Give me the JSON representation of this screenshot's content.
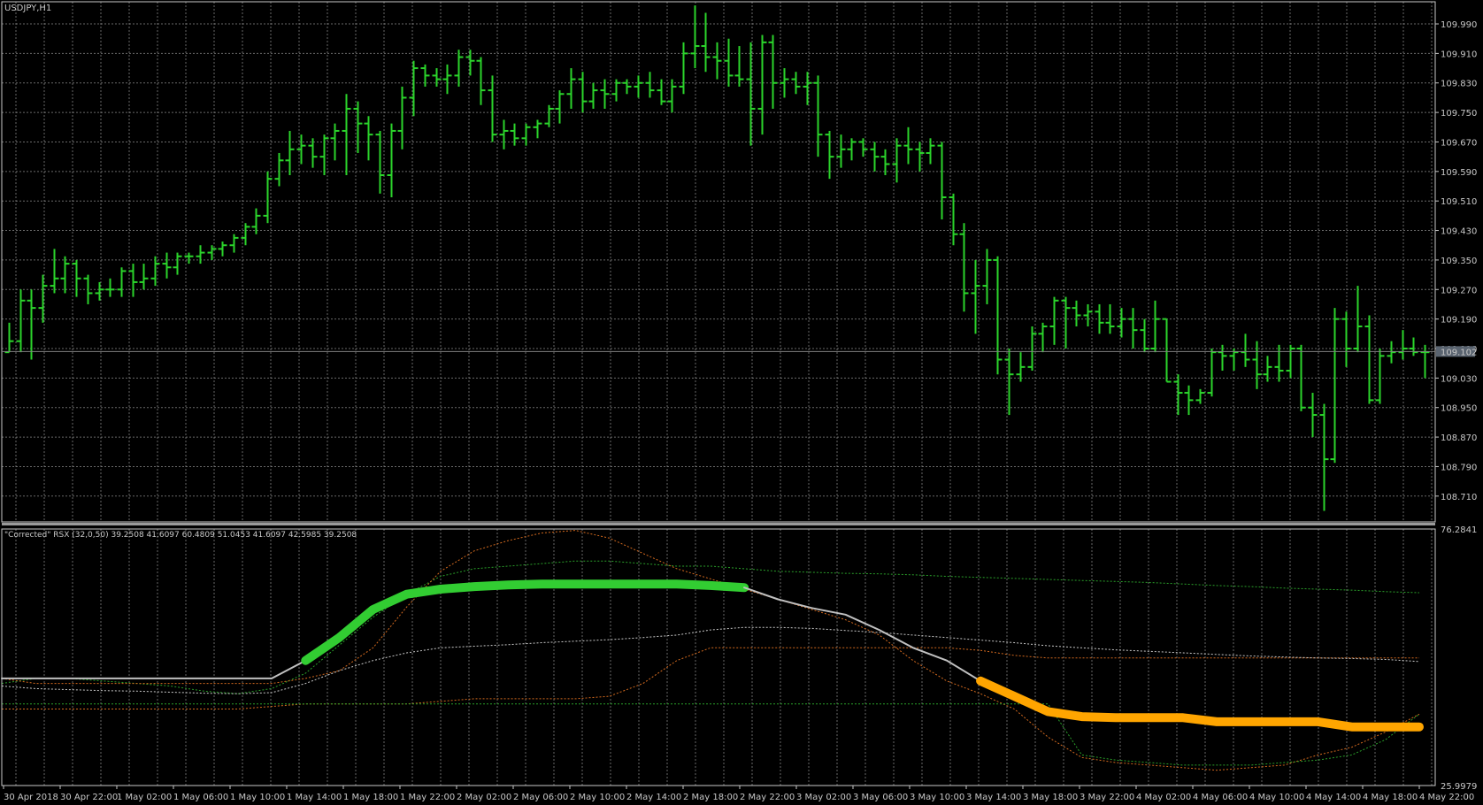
{
  "window": {
    "symbol_label": "USDJPY,H1",
    "indicator_label": "\"Corrected\" RSX (32,0,50) 39.2508 41.6097 60.4809 51.0453 41.6097 42.5985 39.2508"
  },
  "colors": {
    "background": "#000000",
    "grid": "#8c8c8c",
    "bars": "#2bd42b",
    "rsx_up": "#32cd32",
    "rsx_down": "#ffa500",
    "rsx_neutral": "#c0c0c0",
    "band_green": "#2aa02a",
    "band_orange": "#d2691e",
    "band_white": "#c8c8c8",
    "current_price_line": "#808080",
    "current_price_box": "#5a6470"
  },
  "chart_data": [
    {
      "type": "ohlc",
      "series": [
        {
          "name": "USDJPY,H1"
        }
      ],
      "ylim": [
        108.64,
        110.05
      ],
      "y_ticks": [
        "109.990",
        "109.910",
        "109.830",
        "109.750",
        "109.670",
        "109.590",
        "109.510",
        "109.430",
        "109.350",
        "109.270",
        "109.190",
        "109.110",
        "109.030",
        "108.950",
        "108.870",
        "108.790",
        "108.710"
      ],
      "current_price": "109.102",
      "ohlc": [
        [
          109.1,
          109.18,
          109.1,
          109.13
        ],
        [
          109.13,
          109.27,
          109.1,
          109.24
        ],
        [
          109.24,
          109.27,
          109.08,
          109.22
        ],
        [
          109.22,
          109.31,
          109.18,
          109.28
        ],
        [
          109.28,
          109.38,
          109.26,
          109.3
        ],
        [
          109.3,
          109.36,
          109.26,
          109.34
        ],
        [
          109.34,
          109.35,
          109.25,
          109.3
        ],
        [
          109.3,
          109.31,
          109.23,
          109.26
        ],
        [
          109.26,
          109.29,
          109.24,
          109.27
        ],
        [
          109.27,
          109.3,
          109.25,
          109.27
        ],
        [
          109.27,
          109.33,
          109.25,
          109.32
        ],
        [
          109.32,
          109.34,
          109.25,
          109.29
        ],
        [
          109.29,
          109.34,
          109.27,
          109.3
        ],
        [
          109.3,
          109.36,
          109.28,
          109.34
        ],
        [
          109.34,
          109.37,
          109.3,
          109.33
        ],
        [
          109.33,
          109.37,
          109.31,
          109.36
        ],
        [
          109.36,
          109.37,
          109.34,
          109.36
        ],
        [
          109.36,
          109.39,
          109.34,
          109.37
        ],
        [
          109.37,
          109.39,
          109.35,
          109.38
        ],
        [
          109.38,
          109.4,
          109.36,
          109.39
        ],
        [
          109.39,
          109.42,
          109.37,
          109.41
        ],
        [
          109.41,
          109.45,
          109.39,
          109.44
        ],
        [
          109.44,
          109.49,
          109.42,
          109.47
        ],
        [
          109.47,
          109.59,
          109.45,
          109.57
        ],
        [
          109.57,
          109.64,
          109.55,
          109.62
        ],
        [
          109.62,
          109.7,
          109.58,
          109.65
        ],
        [
          109.65,
          109.69,
          109.61,
          109.66
        ],
        [
          109.66,
          109.68,
          109.6,
          109.63
        ],
        [
          109.63,
          109.69,
          109.58,
          109.68
        ],
        [
          109.68,
          109.72,
          109.62,
          109.7
        ],
        [
          109.7,
          109.8,
          109.58,
          109.76
        ],
        [
          109.76,
          109.78,
          109.64,
          109.72
        ],
        [
          109.72,
          109.74,
          109.62,
          109.69
        ],
        [
          109.69,
          109.7,
          109.53,
          109.58
        ],
        [
          109.58,
          109.72,
          109.52,
          109.7
        ],
        [
          109.7,
          109.82,
          109.65,
          109.79
        ],
        [
          109.79,
          109.89,
          109.74,
          109.87
        ],
        [
          109.87,
          109.88,
          109.82,
          109.85
        ],
        [
          109.85,
          109.87,
          109.82,
          109.84
        ],
        [
          109.84,
          109.88,
          109.8,
          109.85
        ],
        [
          109.85,
          109.92,
          109.82,
          109.9
        ],
        [
          109.9,
          109.92,
          109.85,
          109.89
        ],
        [
          109.89,
          109.9,
          109.77,
          109.81
        ],
        [
          109.81,
          109.85,
          109.67,
          109.69
        ],
        [
          109.69,
          109.73,
          109.65,
          109.7
        ],
        [
          109.7,
          109.72,
          109.66,
          109.68
        ],
        [
          109.68,
          109.72,
          109.66,
          109.71
        ],
        [
          109.71,
          109.73,
          109.68,
          109.72
        ],
        [
          109.72,
          109.77,
          109.71,
          109.76
        ],
        [
          109.76,
          109.81,
          109.72,
          109.8
        ],
        [
          109.8,
          109.87,
          109.76,
          109.84
        ],
        [
          109.84,
          109.86,
          109.75,
          109.78
        ],
        [
          109.78,
          109.83,
          109.76,
          109.81
        ],
        [
          109.81,
          109.84,
          109.76,
          109.8
        ],
        [
          109.8,
          109.84,
          109.78,
          109.83
        ],
        [
          109.83,
          109.84,
          109.8,
          109.82
        ],
        [
          109.82,
          109.85,
          109.79,
          109.83
        ],
        [
          109.83,
          109.86,
          109.79,
          109.81
        ],
        [
          109.81,
          109.84,
          109.77,
          109.78
        ],
        [
          109.78,
          109.84,
          109.75,
          109.82
        ],
        [
          109.82,
          109.94,
          109.8,
          109.91
        ],
        [
          109.91,
          110.04,
          109.87,
          109.93
        ],
        [
          109.93,
          110.02,
          109.86,
          109.9
        ],
        [
          109.9,
          109.94,
          109.84,
          109.89
        ],
        [
          109.89,
          109.95,
          109.82,
          109.85
        ],
        [
          109.85,
          109.93,
          109.82,
          109.84
        ],
        [
          109.84,
          109.94,
          109.66,
          109.76
        ],
        [
          109.76,
          109.96,
          109.69,
          109.94
        ],
        [
          109.94,
          109.96,
          109.76,
          109.83
        ],
        [
          109.83,
          109.87,
          109.79,
          109.84
        ],
        [
          109.84,
          109.86,
          109.8,
          109.82
        ],
        [
          109.82,
          109.86,
          109.77,
          109.83
        ],
        [
          109.83,
          109.85,
          109.63,
          109.69
        ],
        [
          109.69,
          109.7,
          109.57,
          109.63
        ],
        [
          109.63,
          109.69,
          109.6,
          109.65
        ],
        [
          109.65,
          109.68,
          109.62,
          109.67
        ],
        [
          109.67,
          109.68,
          109.63,
          109.65
        ],
        [
          109.65,
          109.67,
          109.59,
          109.63
        ],
        [
          109.63,
          109.65,
          109.58,
          109.61
        ],
        [
          109.61,
          109.68,
          109.56,
          109.66
        ],
        [
          109.66,
          109.71,
          109.61,
          109.65
        ],
        [
          109.65,
          109.67,
          109.59,
          109.64
        ],
        [
          109.64,
          109.68,
          109.61,
          109.66
        ],
        [
          109.66,
          109.67,
          109.46,
          109.52
        ],
        [
          109.52,
          109.53,
          109.39,
          109.42
        ],
        [
          109.42,
          109.45,
          109.21,
          109.26
        ],
        [
          109.26,
          109.35,
          109.15,
          109.28
        ],
        [
          109.28,
          109.38,
          109.23,
          109.35
        ],
        [
          109.35,
          109.36,
          109.04,
          109.08
        ],
        [
          109.08,
          109.11,
          108.93,
          109.04
        ],
        [
          109.04,
          109.1,
          109.02,
          109.06
        ],
        [
          109.06,
          109.17,
          109.05,
          109.15
        ],
        [
          109.15,
          109.18,
          109.1,
          109.17
        ],
        [
          109.17,
          109.25,
          109.12,
          109.24
        ],
        [
          109.24,
          109.25,
          109.11,
          109.22
        ],
        [
          109.22,
          109.24,
          109.17,
          109.2
        ],
        [
          109.2,
          109.23,
          109.17,
          109.21
        ],
        [
          109.21,
          109.23,
          109.15,
          109.18
        ],
        [
          109.18,
          109.23,
          109.15,
          109.17
        ],
        [
          109.17,
          109.22,
          109.14,
          109.19
        ],
        [
          109.19,
          109.22,
          109.11,
          109.16
        ],
        [
          109.16,
          109.19,
          109.1,
          109.11
        ],
        [
          109.11,
          109.24,
          109.1,
          109.19
        ],
        [
          109.19,
          109.19,
          109.02,
          109.02
        ],
        [
          109.02,
          109.04,
          108.93,
          108.99
        ],
        [
          108.99,
          109.01,
          108.93,
          108.97
        ],
        [
          108.97,
          109.0,
          108.96,
          108.99
        ],
        [
          108.99,
          109.11,
          108.98,
          109.1
        ],
        [
          109.1,
          109.12,
          109.05,
          109.09
        ],
        [
          109.09,
          109.11,
          109.05,
          109.1
        ],
        [
          109.1,
          109.15,
          109.06,
          109.08
        ],
        [
          109.08,
          109.13,
          109.0,
          109.04
        ],
        [
          109.04,
          109.09,
          109.02,
          109.06
        ],
        [
          109.06,
          109.12,
          109.02,
          109.05
        ],
        [
          109.05,
          109.12,
          109.03,
          109.11
        ],
        [
          109.11,
          109.12,
          108.94,
          108.95
        ],
        [
          108.95,
          108.99,
          108.87,
          108.93
        ],
        [
          108.93,
          108.96,
          108.67,
          108.81
        ],
        [
          108.81,
          109.22,
          108.8,
          109.19
        ],
        [
          109.19,
          109.21,
          109.06,
          109.11
        ],
        [
          109.11,
          109.28,
          109.1,
          109.17
        ],
        [
          109.17,
          109.2,
          108.96,
          108.97
        ],
        [
          108.97,
          109.11,
          108.96,
          109.09
        ],
        [
          109.09,
          109.13,
          109.07,
          109.1
        ],
        [
          109.1,
          109.16,
          109.08,
          109.11
        ],
        [
          109.11,
          109.14,
          109.09,
          109.1
        ],
        [
          109.1,
          109.12,
          109.03,
          109.1
        ]
      ]
    },
    {
      "type": "line",
      "title": "\"Corrected\" RSX (32,0,50)",
      "ylim": [
        25.9979,
        76.2841
      ],
      "y_ticks": [
        "76.2841",
        "25.9979"
      ],
      "series": [
        {
          "color": "#2aa02a",
          "values": [
            46.0,
            47.0,
            47.0,
            46.5,
            46.0,
            45.5,
            44.5,
            44.0,
            45.0,
            48.0,
            53.5,
            59.0,
            63.5,
            67.0,
            68.5,
            69.0,
            69.5,
            70.0,
            70.0,
            69.5,
            69.0,
            69.0,
            68.5,
            68.0,
            67.8,
            67.6,
            67.5,
            67.3,
            67.0,
            66.8,
            66.6,
            66.4,
            66.2,
            66.0,
            65.8,
            65.5,
            65.2,
            65.0,
            64.7,
            64.5,
            64.3,
            64.0,
            63.8
          ]
        },
        {
          "color": "#d2691e",
          "values": [
            41.0,
            41.0,
            41.0,
            41.0,
            41.0,
            41.0,
            41.0,
            41.0,
            41.5,
            42.0,
            42.0,
            42.0,
            42.0,
            42.5,
            43.0,
            43.0,
            43.0,
            43.0,
            43.5,
            46.0,
            50.5,
            53.0,
            53.0,
            53.0,
            53.0,
            53.0,
            53.0,
            53.0,
            53.0,
            52.5,
            51.5,
            51.0,
            51.0,
            51.0,
            51.0,
            51.0,
            51.0,
            51.0,
            51.0,
            51.0,
            51.0,
            51.0,
            51.0
          ]
        },
        {
          "color": "#d2691e",
          "values": [
            47.0,
            46.0,
            46.0,
            46.0,
            46.0,
            46.0,
            46.0,
            46.0,
            46.0,
            47.0,
            48.5,
            53.0,
            61.0,
            68.0,
            72.0,
            74.0,
            75.5,
            76.0,
            74.5,
            71.5,
            68.5,
            66.5,
            64.5,
            62.5,
            60.5,
            58.5,
            55.5,
            50.5,
            46.5,
            44.0,
            41.0,
            35.5,
            31.5,
            30.5,
            30.0,
            29.5,
            29.0,
            29.5,
            30.0,
            32.0,
            33.5,
            36.5,
            40.0
          ]
        },
        {
          "color": "#2aa02a",
          "values": [
            42.0,
            42.0,
            42.0,
            42.0,
            42.0,
            42.0,
            42.0,
            42.0,
            42.0,
            42.0,
            42.0,
            42.0,
            42.0,
            42.0,
            42.0,
            42.0,
            42.0,
            42.0,
            42.0,
            42.0,
            42.0,
            42.0,
            42.0,
            42.0,
            42.0,
            42.0,
            42.0,
            42.0,
            42.0,
            42.0,
            42.0,
            42.0,
            32.0,
            31.0,
            30.5,
            30.0,
            30.0,
            30.0,
            30.5,
            31.0,
            32.0,
            35.0,
            40.0
          ]
        },
        {
          "color": "#c8c8c8",
          "values": [
            45.5,
            45.0,
            44.8,
            44.6,
            44.5,
            44.3,
            44.1,
            44.0,
            44.2,
            46.0,
            48.5,
            50.5,
            52.0,
            53.0,
            53.3,
            53.6,
            54.0,
            54.3,
            54.6,
            55.0,
            55.5,
            56.5,
            57.0,
            57.0,
            56.8,
            56.4,
            56.0,
            55.5,
            55.0,
            54.5,
            54.0,
            53.4,
            53.0,
            52.6,
            52.3,
            52.0,
            51.7,
            51.4,
            51.2,
            51.0,
            50.9,
            50.7,
            50.3
          ]
        },
        {
          "color": "#c0c0c0",
          "values": [
            47.0,
            47.0,
            47.0,
            47.0,
            47.0,
            47.0,
            47.0,
            47.0,
            47.0,
            50.5,
            55.0,
            60.5,
            63.5,
            64.5,
            65.0,
            65.3,
            65.5,
            65.5,
            65.5,
            65.5,
            65.5,
            65.2,
            64.8,
            62.5,
            60.8,
            59.5,
            56.5,
            53.0,
            50.5,
            46.5,
            43.5,
            40.5,
            39.5,
            39.3,
            39.3,
            39.3,
            38.5,
            38.5,
            38.5,
            38.5,
            37.5,
            37.5,
            37.5
          ],
          "segments": [
            {
              "color": "#c0c0c0",
              "from": 0,
              "to": 9
            },
            {
              "color": "#32cd32",
              "from": 9,
              "to": 22
            },
            {
              "color": "#c0c0c0",
              "from": 22,
              "to": 29
            },
            {
              "color": "#ffa500",
              "from": 29,
              "to": 42
            }
          ]
        }
      ]
    }
  ],
  "x_axis": {
    "labels": [
      "30 Apr 2018",
      "30 Apr 22:00",
      "1 May 02:00",
      "1 May 06:00",
      "1 May 10:00",
      "1 May 14:00",
      "1 May 18:00",
      "1 May 22:00",
      "2 May 02:00",
      "2 May 06:00",
      "2 May 10:00",
      "2 May 14:00",
      "2 May 18:00",
      "2 May 22:00",
      "3 May 02:00",
      "3 May 06:00",
      "3 May 10:00",
      "3 May 14:00",
      "3 May 18:00",
      "3 May 22:00",
      "4 May 02:00",
      "4 May 06:00",
      "4 May 10:00",
      "4 May 14:00",
      "4 May 18:00",
      "4 May 22:00"
    ]
  }
}
